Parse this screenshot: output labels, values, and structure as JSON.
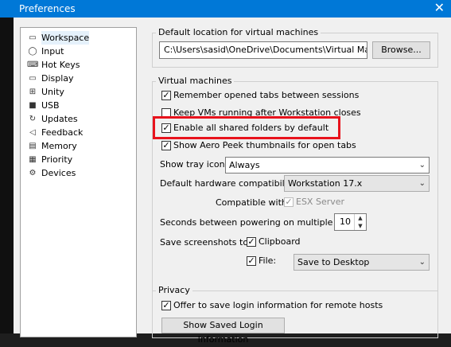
{
  "window": {
    "title": "Preferences",
    "close_glyph": "✕"
  },
  "sidebar": {
    "items": [
      {
        "label": "Workspace",
        "icon": "workspace-icon",
        "glyph": "▭"
      },
      {
        "label": "Input",
        "icon": "mouse-icon",
        "glyph": "◯"
      },
      {
        "label": "Hot Keys",
        "icon": "keyboard-icon",
        "glyph": "⌨"
      },
      {
        "label": "Display",
        "icon": "monitor-icon",
        "glyph": "▭"
      },
      {
        "label": "Unity",
        "icon": "unity-icon",
        "glyph": "⊞"
      },
      {
        "label": "USB",
        "icon": "usb-icon",
        "glyph": "■"
      },
      {
        "label": "Updates",
        "icon": "updates-icon",
        "glyph": "↻"
      },
      {
        "label": "Feedback",
        "icon": "feedback-icon",
        "glyph": "◁"
      },
      {
        "label": "Memory",
        "icon": "memory-icon",
        "glyph": "▤"
      },
      {
        "label": "Priority",
        "icon": "priority-icon",
        "glyph": "▦"
      },
      {
        "label": "Devices",
        "icon": "devices-icon",
        "glyph": "⚙"
      }
    ]
  },
  "default_location": {
    "legend": "Default location for virtual machines",
    "path": "C:\\Users\\sasid\\OneDrive\\Documents\\Virtual Machine",
    "browse_label": "Browse..."
  },
  "virtual_machines": {
    "legend": "Virtual machines",
    "checkboxes": [
      {
        "label": "Remember opened tabs between sessions",
        "checked": "✓"
      },
      {
        "label": "Keep VMs running after Workstation closes",
        "checked": ""
      },
      {
        "label": "Enable all shared folders by default",
        "checked": "✓"
      },
      {
        "label": "Show Aero Peek thumbnails for open tabs",
        "checked": "✓"
      }
    ],
    "tray_icon_label": "Show tray icon:",
    "tray_icon_value": "Always",
    "hw_compat_label": "Default hardware compatibility:",
    "hw_compat_value": "Workstation 17.x",
    "compatible_with_label": "Compatible with:",
    "esx_label": "ESX Server",
    "esx_checked": "✓",
    "seconds_label": "Seconds between powering on multiple VMs:",
    "seconds_value": "10",
    "screenshots_label": "Save screenshots to:",
    "clipboard_label": "Clipboard",
    "clipboard_checked": "✓",
    "file_label": "File:",
    "file_checked": "✓",
    "file_value": "Save to Desktop",
    "dropdown_glyph": "⌄"
  },
  "privacy": {
    "legend": "Privacy",
    "offer_label": "Offer to save login information for remote hosts",
    "offer_checked": "✓",
    "show_saved_label": "Show Saved Login Information"
  },
  "colors": {
    "titlebar": "#0078d7",
    "highlight": "#e8121c",
    "background": "#f0f0f0"
  }
}
